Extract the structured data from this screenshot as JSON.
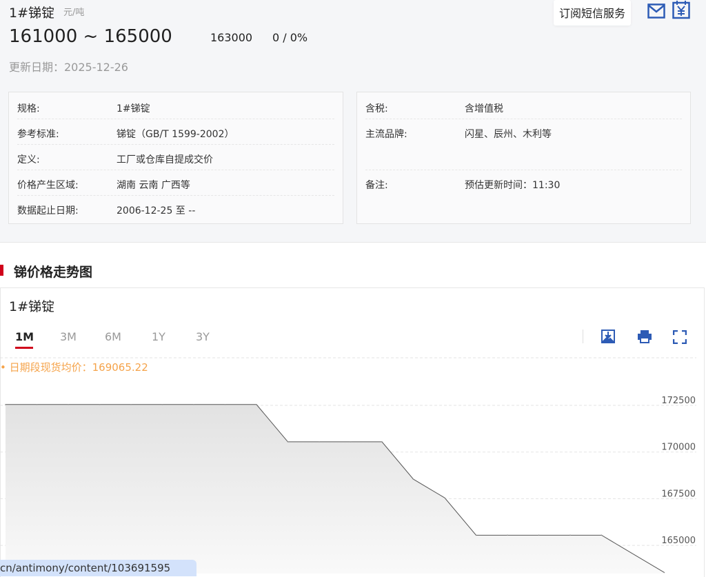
{
  "header": {
    "name": "1#锑锭",
    "unit": "元/吨",
    "range": "161000 ~ 165000",
    "average": "163000",
    "change": "0 / 0%",
    "update": "更新日期：2025-12-26",
    "subscribe": "订阅短信服务"
  },
  "info_left": [
    {
      "k": "规格:",
      "v": "1#锑锭"
    },
    {
      "k": "参考标准:",
      "v": "锑锭（GB/T 1599-2002）"
    },
    {
      "k": "定义:",
      "v": "工厂或仓库自提成交价"
    },
    {
      "k": "价格产生区域:",
      "v": "湖南 云南 广西等"
    },
    {
      "k": "数据起止日期:",
      "v": "2006-12-25 至 --"
    }
  ],
  "info_right": [
    {
      "k": "含税:",
      "v": "含增值税"
    },
    {
      "k": "主流品牌:",
      "v": "闪星、辰州、木利等"
    },
    {
      "k": "备注:",
      "v": "预估更新时间：11:30"
    }
  ],
  "section_title": "锑价格走势图",
  "chart_title": "1#锑锭",
  "tabs": [
    "1M",
    "3M",
    "6M",
    "1Y",
    "3Y"
  ],
  "avg_label": "• 日期段现货均价：169065.22",
  "url": "cn/antimony/content/103691595",
  "chart_data": {
    "type": "area",
    "title": "1#锑锭",
    "yticks": [
      "172500",
      "170000",
      "167500",
      "165000"
    ],
    "ylim": [
      162500,
      174500
    ],
    "values": [
      172250,
      172250,
      172250,
      172250,
      172250,
      172250,
      172250,
      172250,
      172250,
      170250,
      170250,
      170250,
      170250,
      168250,
      167250,
      165250,
      165250,
      165250,
      165250,
      165250,
      164250,
      163250
    ]
  }
}
